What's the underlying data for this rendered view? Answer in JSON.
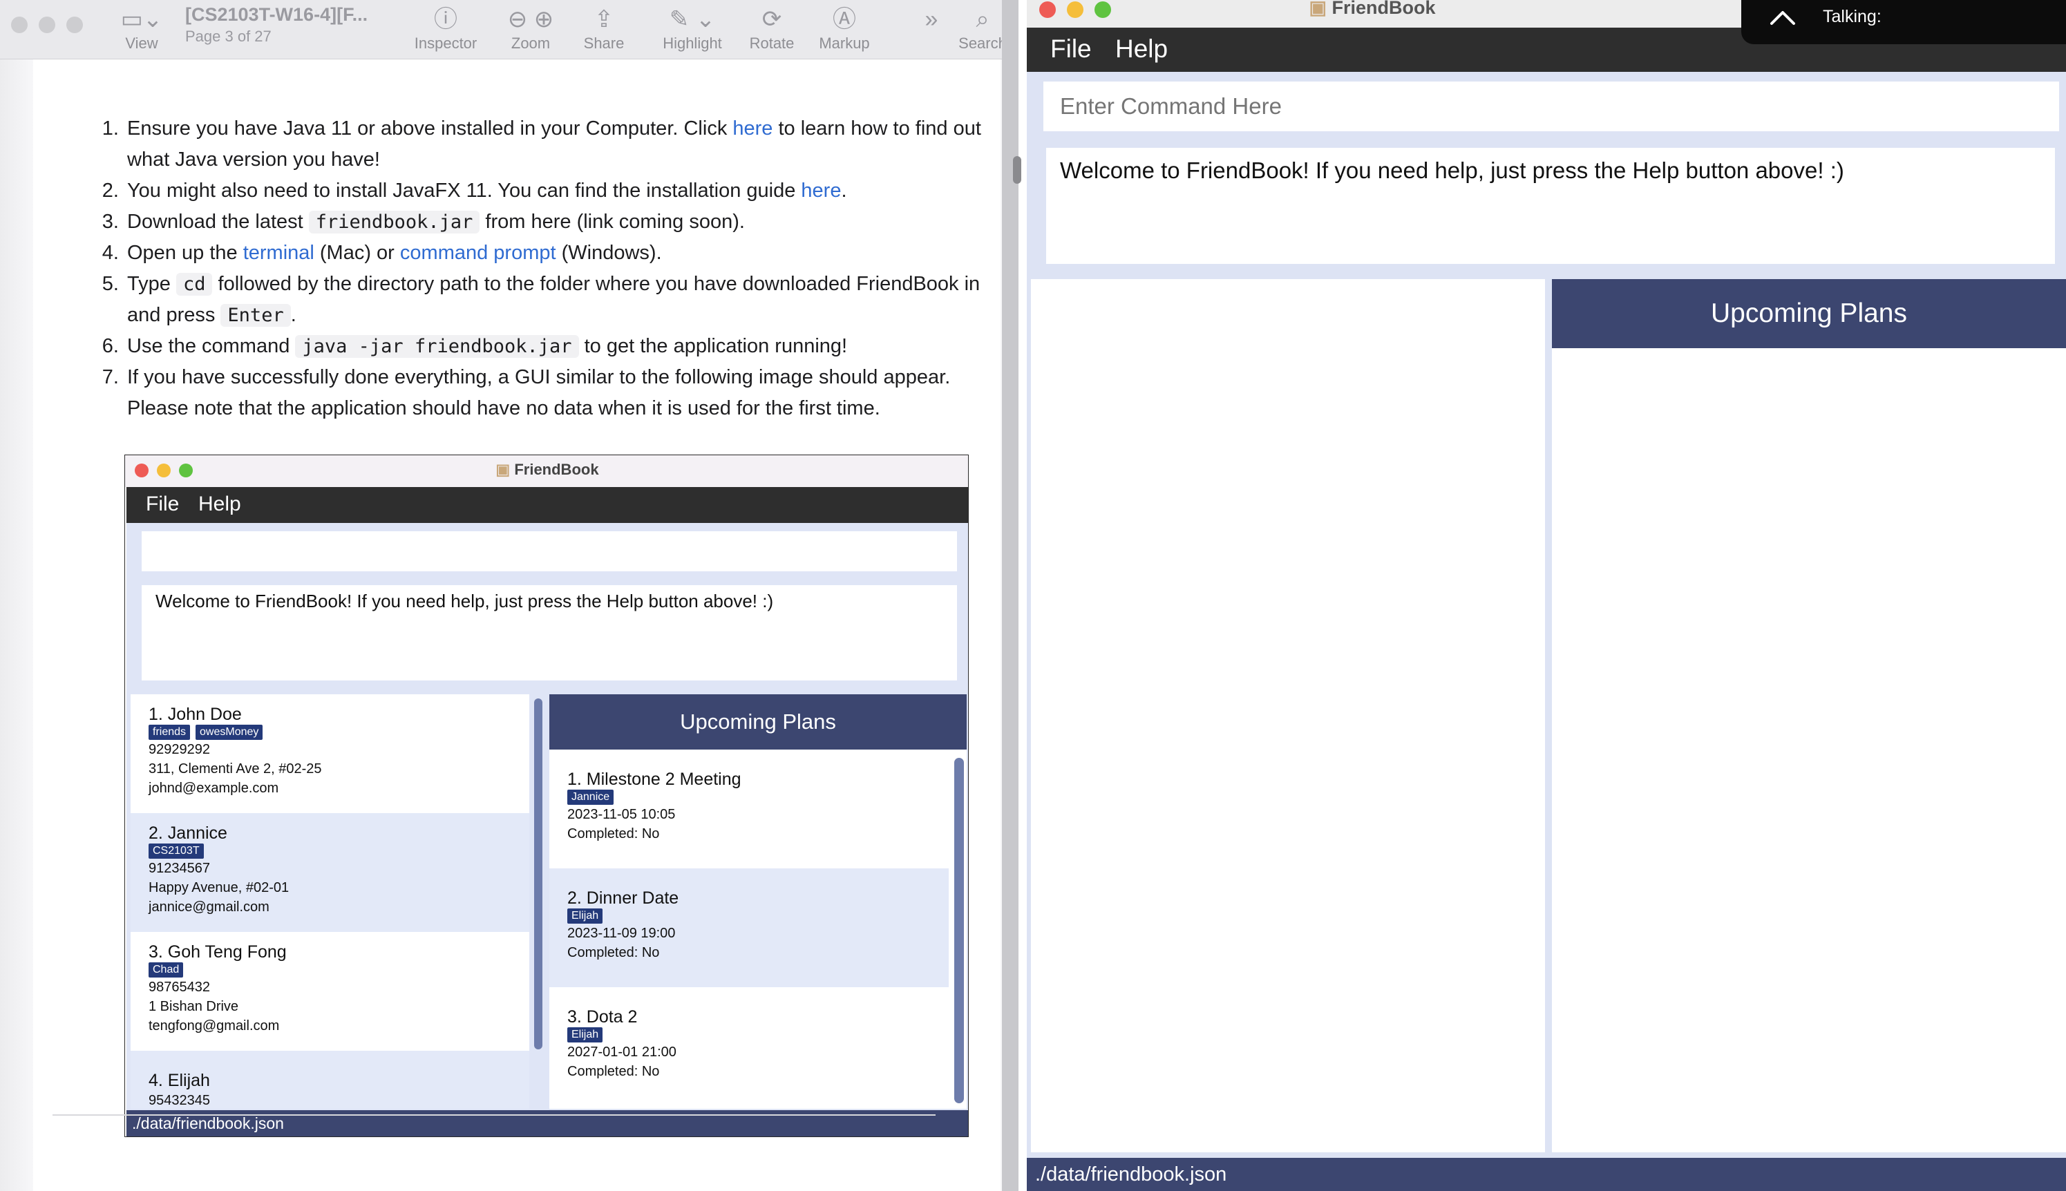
{
  "preview": {
    "doc_title": "[CS2103T-W16-4][F...",
    "page_info": "Page 3 of 27",
    "toolbar": [
      {
        "label": "View",
        "icon": "sidebar-icon"
      },
      {
        "label": "Inspector",
        "icon": "info-icon"
      },
      {
        "label": "Zoom",
        "icon": "zoom-icon"
      },
      {
        "label": "Share",
        "icon": "share-icon"
      },
      {
        "label": "Highlight",
        "icon": "highlight-icon"
      },
      {
        "label": "Rotate",
        "icon": "rotate-icon"
      },
      {
        "label": "Markup",
        "icon": "markup-icon"
      },
      {
        "label": "Search",
        "icon": "search-icon"
      }
    ],
    "steps": {
      "s1_a": "Ensure you have Java 11 or above installed in your Computer. Click ",
      "s1_link": "here",
      "s1_b": " to learn how to find out what Java version you have!",
      "s2_a": "You might also need to install JavaFX 11. You can find the installation guide ",
      "s2_link": "here",
      "s2_b": ".",
      "s3_a": "Download the latest ",
      "s3_code": "friendbook.jar",
      "s3_b": " from here (link coming soon).",
      "s4_a": "Open up the ",
      "s4_link1": "terminal",
      "s4_b": " (Mac) or ",
      "s4_link2": "command prompt",
      "s4_c": " (Windows).",
      "s5_a": "Type ",
      "s5_code1": "cd",
      "s5_b": " followed by the directory path to the folder where you have downloaded FriendBook in and press ",
      "s5_code2": "Enter",
      "s5_c": ".",
      "s6_a": "Use the command ",
      "s6_code": "java -jar friendbook.jar",
      "s6_b": " to get the application running!",
      "s7": "If you have successfully done everything, a GUI similar to the following image should appear. Please note that the application should have no data when it is used for the first time."
    }
  },
  "screenshot": {
    "title": "FriendBook",
    "menu_file": "File",
    "menu_help": "Help",
    "result": "Welcome to FriendBook! If you need help, just press the Help button above! :)",
    "persons": [
      {
        "name": "1.  John Doe",
        "tags": [
          "friends",
          "owesMoney"
        ],
        "phone": "92929292",
        "address": "311, Clementi Ave 2, #02-25",
        "email": "johnd@example.com"
      },
      {
        "name": "2.  Jannice",
        "tags": [
          "CS2103T"
        ],
        "phone": "91234567",
        "address": "Happy Avenue, #02-01",
        "email": "jannice@gmail.com"
      },
      {
        "name": "3.  Goh Teng Fong",
        "tags": [
          "Chad"
        ],
        "phone": "98765432",
        "address": "1 Bishan Drive",
        "email": "tengfong@gmail.com"
      },
      {
        "name": "4.  Elijah",
        "tags": [],
        "phone": "95432345",
        "address": "",
        "email": ""
      }
    ],
    "plans_header": "Upcoming Plans",
    "plans": [
      {
        "name": "1.  Milestone 2 Meeting",
        "tag": "Jannice",
        "datetime": "2023-11-05 10:05",
        "completed": "Completed: No"
      },
      {
        "name": "2.  Dinner Date",
        "tag": "Elijah",
        "datetime": "2023-11-09 19:00",
        "completed": "Completed: No"
      },
      {
        "name": "3.  Dota 2",
        "tag": "Elijah",
        "datetime": "2027-01-01 21:00",
        "completed": "Completed: No"
      }
    ],
    "status": "./data/friendbook.json"
  },
  "app": {
    "title": "FriendBook",
    "menu_file": "File",
    "menu_help": "Help",
    "command_placeholder": "Enter Command Here",
    "result": "Welcome to FriendBook! If you need help, just press the Help button above! :)",
    "plans_header": "Upcoming Plans",
    "status": "./data/friendbook.json"
  },
  "overlay": {
    "label": "Talking:"
  },
  "colors": {
    "menu_bg": "#2e2e2e",
    "accent": "#3c4670",
    "tag_bg": "#243a7a",
    "panel_bg": "#dde3f4",
    "link": "#2f6bd1"
  }
}
